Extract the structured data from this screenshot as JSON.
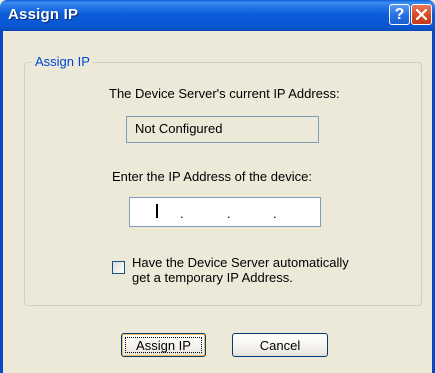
{
  "window": {
    "title": "Assign IP",
    "help_symbol": "?",
    "frame_color": "#0a47c8",
    "titlebar_color": "#0a58d6"
  },
  "group": {
    "legend": "Assign IP",
    "current_ip_label": "The Device Server's current IP Address:",
    "current_ip_value": "Not Configured",
    "enter_ip_label": "Enter the IP Address of the device:",
    "ip_separator": ".",
    "ip_octets": [
      "",
      "",
      "",
      ""
    ],
    "auto_ip_line1": "Have the Device Server automatically",
    "auto_ip_line2": "get a temporary IP Address.",
    "auto_ip_checked": false
  },
  "buttons": {
    "assign_label": "Assign IP",
    "cancel_label": "Cancel"
  },
  "icons": {
    "help": "help-icon",
    "close": "close-icon"
  }
}
